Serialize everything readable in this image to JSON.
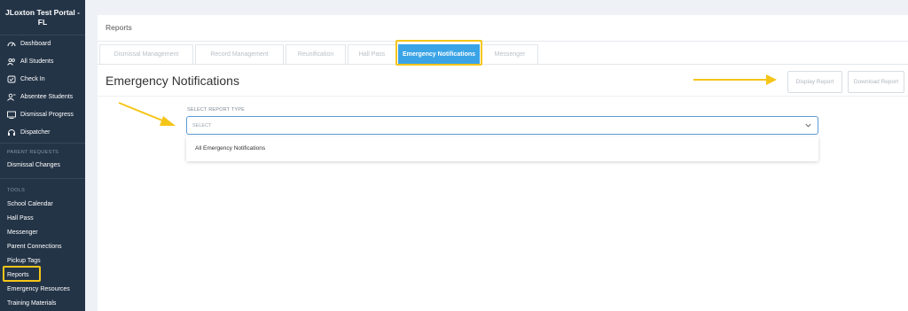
{
  "sidebar": {
    "title_line1": "JLoxton Test Portal -",
    "title_line2": "FL",
    "items": [
      {
        "label": "Dashboard",
        "icon": "dashboard-icon"
      },
      {
        "label": "All Students",
        "icon": "users-icon"
      },
      {
        "label": "Check In",
        "icon": "check-in-icon"
      },
      {
        "label": "Absentee Students",
        "icon": "user-minus-icon"
      },
      {
        "label": "Dismissal Progress",
        "icon": "progress-icon"
      },
      {
        "label": "Dispatcher",
        "icon": "dispatcher-icon"
      }
    ],
    "parent_requests_heading": "PARENT REQUESTS",
    "parent_requests": [
      {
        "label": "Dismissal Changes"
      }
    ],
    "tools_heading": "TOOLS",
    "tools": [
      {
        "label": "School Calendar"
      },
      {
        "label": "Hall Pass"
      },
      {
        "label": "Messenger"
      },
      {
        "label": "Parent Connections"
      },
      {
        "label": "Pickup Tags"
      },
      {
        "label": "Reports"
      },
      {
        "label": "Emergency Resources"
      },
      {
        "label": "Training Materials"
      }
    ]
  },
  "header": {
    "title": "Reports"
  },
  "tabs": [
    {
      "label": "Dismissal Management"
    },
    {
      "label": "Record Management"
    },
    {
      "label": "Reunification"
    },
    {
      "label": "Hall Pass"
    },
    {
      "label": "Emergency Notifications",
      "active": true
    },
    {
      "label": "Messenger"
    }
  ],
  "section": {
    "title": "Emergency Notifications",
    "display_report_label": "Display Report",
    "download_report_label": "Download Report"
  },
  "report_type": {
    "label": "SELECT REPORT TYPE",
    "placeholder": "SELECT",
    "options": [
      "All Emergency Notifications"
    ]
  },
  "colors": {
    "sidebar_bg": "#243447",
    "active_tab": "#3aa4e6",
    "highlight": "#f5c518",
    "select_border": "#5b9bd5"
  }
}
